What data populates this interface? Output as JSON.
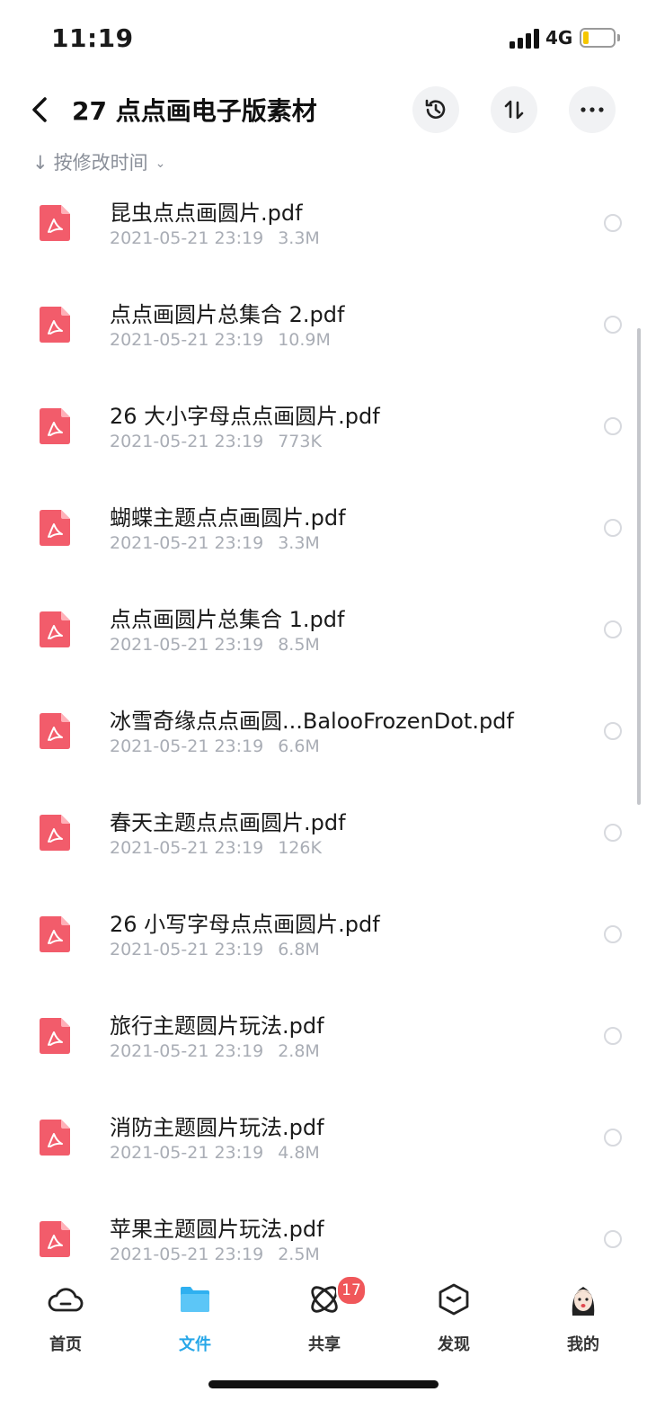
{
  "status_bar": {
    "time": "11:19",
    "network": "4G",
    "battery_level": 0.2,
    "battery_color": "#f5c700"
  },
  "header": {
    "title": "27 点点画电子版素材",
    "back_icon": "chevron-left-icon",
    "history_icon": "history-icon",
    "sort_icon": "sort-arrows-icon",
    "more_icon": "more-dots-icon"
  },
  "sort": {
    "label": "按修改时间",
    "arrow": "↓"
  },
  "files": [
    {
      "name": "昆虫点点画圆片.pdf",
      "date": "2021-05-21 23:19",
      "size": "3.3M"
    },
    {
      "name": "点点画圆片总集合 2.pdf",
      "date": "2021-05-21 23:19",
      "size": "10.9M"
    },
    {
      "name": "26 大小字母点点画圆片.pdf",
      "date": "2021-05-21 23:19",
      "size": "773K"
    },
    {
      "name": "蝴蝶主题点点画圆片.pdf",
      "date": "2021-05-21 23:19",
      "size": "3.3M"
    },
    {
      "name": "点点画圆片总集合 1.pdf",
      "date": "2021-05-21 23:19",
      "size": "8.5M"
    },
    {
      "name": "冰雪奇缘点点画圆...BalooFrozenDot.pdf",
      "date": "2021-05-21 23:19",
      "size": "6.6M"
    },
    {
      "name": "春天主题点点画圆片.pdf",
      "date": "2021-05-21 23:19",
      "size": "126K"
    },
    {
      "name": "26 小写字母点点画圆片.pdf",
      "date": "2021-05-21 23:19",
      "size": "6.8M"
    },
    {
      "name": "旅行主题圆片玩法.pdf",
      "date": "2021-05-21 23:19",
      "size": "2.8M"
    },
    {
      "name": "消防主题圆片玩法.pdf",
      "date": "2021-05-21 23:19",
      "size": "4.8M"
    },
    {
      "name": "苹果主题圆片玩法.pdf",
      "date": "2021-05-21 23:19",
      "size": "2.5M"
    }
  ],
  "file_icon": "pdf-icon",
  "colors": {
    "pdf_icon": "#f25c6b",
    "accent": "#27a7e8",
    "badge": "#f0575a"
  },
  "tabs": [
    {
      "label": "首页",
      "icon": "cloud-icon",
      "active": false
    },
    {
      "label": "文件",
      "icon": "folder-icon",
      "active": true
    },
    {
      "label": "共享",
      "icon": "orbit-icon",
      "active": false,
      "badge": "17"
    },
    {
      "label": "发现",
      "icon": "cube-icon",
      "active": false
    },
    {
      "label": "我的",
      "icon": "avatar-icon",
      "active": false
    }
  ]
}
